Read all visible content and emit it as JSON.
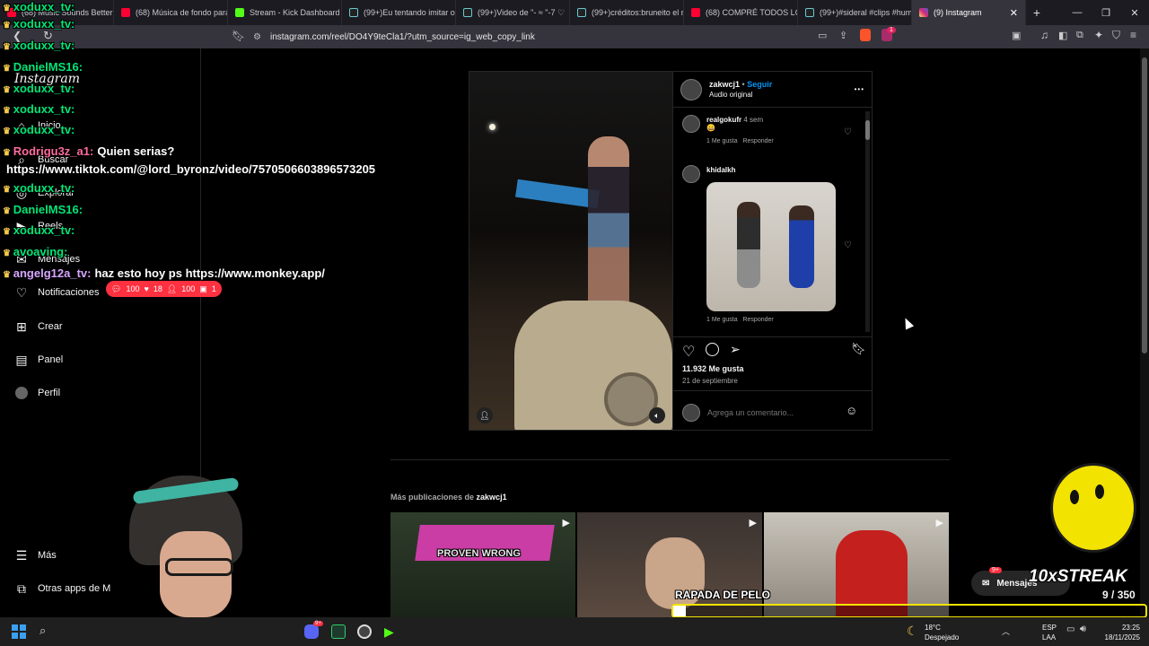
{
  "browser": {
    "tabs": [
      {
        "label": "(68) Music Sounds Better"
      },
      {
        "label": "(68) Música de fondo para"
      },
      {
        "label": "Stream - Kick Dashboard"
      },
      {
        "label": "(99+)Eu tentando imitar o"
      },
      {
        "label": "(99+)Video de \"- ≈ \"-7 ♡"
      },
      {
        "label": "(99+)créditos:bruneito el r"
      },
      {
        "label": "(68) COMPRÉ TODOS LOS"
      },
      {
        "label": "(99+)#sideral #clips #hum"
      },
      {
        "label": "(9) Instagram"
      }
    ],
    "new_tab": "+",
    "url": "instagram.com/reel/DO4Y9teCla1/?utm_source=ig_web_copy_link",
    "brave_badge": "1"
  },
  "sidebar": {
    "logo": "Instagram",
    "items": [
      {
        "label": "Inicio",
        "icon": "home-icon"
      },
      {
        "label": "Buscar",
        "icon": "search-icon"
      },
      {
        "label": "Explorar",
        "icon": "compass-icon"
      },
      {
        "label": "Reels",
        "icon": "reels-icon"
      },
      {
        "label": "Mensajes",
        "icon": "messenger-icon"
      },
      {
        "label": "Notificaciones",
        "icon": "heart-icon"
      },
      {
        "label": "Crear",
        "icon": "plus-square-icon"
      },
      {
        "label": "Panel",
        "icon": "chart-icon"
      },
      {
        "label": "Perfil",
        "icon": "avatar-icon"
      }
    ],
    "notif_badge": {
      "comments": "100",
      "likes": "18",
      "followers": "100",
      "requests": "1"
    },
    "more": "Más",
    "other_apps": "Otras apps de M"
  },
  "post": {
    "username": "zakwcj1",
    "separator": "•",
    "follow": "Seguir",
    "audio": "Audio original",
    "options": "•••",
    "comments": [
      {
        "user": "realgokufr",
        "time": "4 sem",
        "text": "😄",
        "likes": "1 Me gusta",
        "reply": "Responder"
      },
      {
        "user": "khidalkh",
        "time": "",
        "text": "",
        "likes": "1 Me gusta",
        "reply": "Responder"
      }
    ],
    "likes": "11.932 Me gusta",
    "date": "21 de septiembre",
    "comment_placeholder": "Agrega un comentario..."
  },
  "more_posts": {
    "label": "Más publicaciones de",
    "user": "zakwcj1",
    "thumb_captions": [
      "PROVEN WRONG",
      "RAPADA DE PELO"
    ]
  },
  "chat_overlay": {
    "lines": [
      {
        "user": "xoduxx_tv:",
        "msg": ""
      },
      {
        "user": "xoduxx_tv:",
        "msg": ""
      },
      {
        "user": "xoduxx_tv:",
        "msg": ""
      },
      {
        "user": "DanielMS16:",
        "msg": ""
      },
      {
        "user": "xoduxx_tv:",
        "msg": ""
      },
      {
        "user": "xoduxx_tv:",
        "msg": ""
      },
      {
        "user": "xoduxx_tv:",
        "msg": ""
      },
      {
        "user": "Rodrigu3z_a1:",
        "msg": "Quien serias?"
      },
      {
        "user": "",
        "msg": "https://www.tiktok.com/@lord_byronz/video/7570506603896573205"
      },
      {
        "user": "xoduxx_tv:",
        "msg": ""
      },
      {
        "user": "DanielMS16:",
        "msg": ""
      },
      {
        "user": "xoduxx_tv:",
        "msg": ""
      },
      {
        "user": "avoaving:",
        "msg": ""
      },
      {
        "user": "angelg12a_tv:",
        "msg": "haz esto hoy ps https://www.monkey.app/"
      }
    ]
  },
  "stream_widget": {
    "label": "10xSTREAK",
    "count": "9",
    "total": "/ 350",
    "progress": 0.026,
    "messages_button": "Mensajes",
    "messages_badge": "9+"
  },
  "taskbar": {
    "weather_temp": "18°C",
    "weather_text": "Despejado",
    "lang1": "ESP",
    "lang2": "LAA",
    "time": "23:25",
    "date": "18/11/2025",
    "chat_badge": "9+"
  },
  "colors": {
    "accent": "#0095f6",
    "chat_green": "#00e676",
    "chat_pink": "#ff6b9d",
    "badge_red": "#ff3040",
    "streak_yellow": "#f2e300"
  }
}
